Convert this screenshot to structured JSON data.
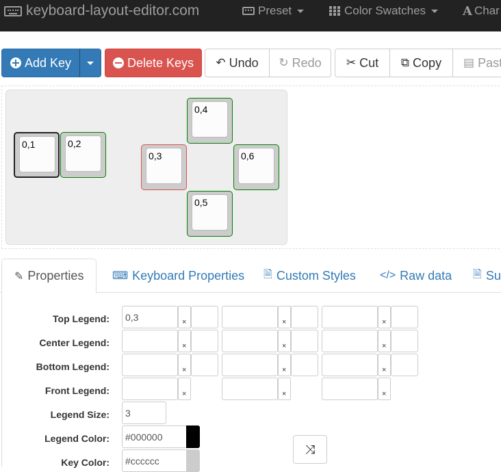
{
  "navbar": {
    "brand": "keyboard-layout-editor.com",
    "preset": "Preset",
    "color_swatches": "Color Swatches",
    "characters": "Char"
  },
  "toolbar": {
    "add_key": "Add Key",
    "delete_keys": "Delete Keys",
    "undo": "Undo",
    "redo": "Redo",
    "cut": "Cut",
    "copy": "Copy",
    "paste": "Past"
  },
  "keys": [
    {
      "label": "0,1",
      "state": "selected-black"
    },
    {
      "label": "0,2",
      "state": "green"
    },
    {
      "label": "0,3",
      "state": "red"
    },
    {
      "label": "0,4",
      "state": "green"
    },
    {
      "label": "0,5",
      "state": "green"
    },
    {
      "label": "0,6",
      "state": "green"
    }
  ],
  "tabs": {
    "properties": "Properties",
    "keyboard_properties": "Keyboard Properties",
    "custom_styles": "Custom Styles",
    "raw_data": "Raw data",
    "summary": "Su"
  },
  "form": {
    "top_legend_label": "Top Legend:",
    "center_legend_label": "Center Legend:",
    "bottom_legend_label": "Bottom Legend:",
    "front_legend_label": "Front Legend:",
    "legend_size_label": "Legend Size:",
    "legend_color_label": "Legend Color:",
    "key_color_label": "Key Color:",
    "top_legend_value": "0,3",
    "legend_size_value": "3",
    "legend_color_value": "#000000",
    "key_color_value": "#cccccc",
    "clear_glyph": "×"
  },
  "colors": {
    "navbar_bg": "#222222",
    "primary": "#337ab7",
    "danger": "#d9534f",
    "legend_color": "#000000",
    "key_color": "#cccccc"
  }
}
